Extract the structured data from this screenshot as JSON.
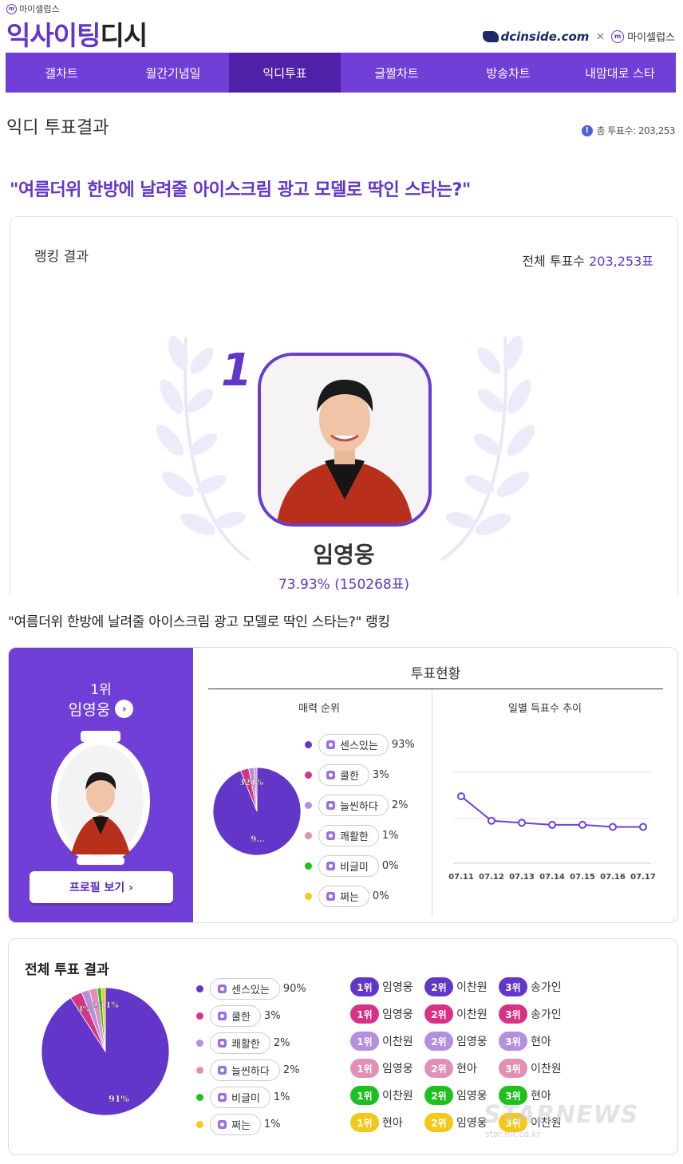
{
  "header": {
    "brand_small": "마이셀럽스",
    "brand_big_part1": "익사이팅",
    "brand_big_part2": "디시",
    "partner_dc": "dcinside.com",
    "partner_times": "×",
    "partner_ms": "마이셀럽스"
  },
  "nav": {
    "items": [
      "갤차트",
      "월간기념일",
      "익디투표",
      "글짤차트",
      "방송차트",
      "내맘대로 스타"
    ],
    "active_index": 2
  },
  "page": {
    "title": "익디 투표결과",
    "total_votes_small": "총 투표수: 203,253",
    "question": "\"여름더위 한방에 날려줄 아이스크림 광고 모델로 딱인 스타는?\""
  },
  "winner": {
    "section_label": "랭킹 결과",
    "total_label": "전체 투표수 ",
    "total_value": "203,253표",
    "rank": "1",
    "name": "임영웅",
    "stats": "73.93% (150268표)"
  },
  "ranking": {
    "heading": "\"여름더위 한방에 날려줄 아이스크림 광고 모델로 딱인 스타는?\" 랭킹",
    "rank_label": "1위",
    "name": "임영웅",
    "profile_button": "프로필 보기 ›",
    "vote_status_title": "투표현황",
    "charm_title": "매력 순위",
    "daily_title": "일별 득표수 추이"
  },
  "colors": {
    "accent": "#6f3fd8",
    "accent_dark": "#4e21a8",
    "pink": "#d63384",
    "lavender": "#b48fe0",
    "lightpink": "#e38fb5",
    "green": "#1fbf1f",
    "yellow": "#f2c81a"
  },
  "charm": {
    "items": [
      {
        "label": "센스있는",
        "pct": "93%",
        "value": 93,
        "color": "#6236c9"
      },
      {
        "label": "쿨한",
        "pct": "3%",
        "value": 3,
        "color": "#d63384"
      },
      {
        "label": "늘씬하다",
        "pct": "2%",
        "value": 2,
        "color": "#b48fe0"
      },
      {
        "label": "쾌활한",
        "pct": "1%",
        "value": 1,
        "color": "#e38fb5"
      },
      {
        "label": "비글미",
        "pct": "0%",
        "value": 0,
        "color": "#1fbf1f"
      },
      {
        "label": "쩌는",
        "pct": "0%",
        "value": 0,
        "color": "#f2c81a"
      }
    ],
    "pie_labels": [
      "321%",
      "9..."
    ]
  },
  "chart_data": [
    {
      "type": "line",
      "x": [
        "07.11",
        "07.12",
        "07.13",
        "07.14",
        "07.15",
        "07.16",
        "07.17"
      ],
      "y": [
        72,
        60,
        59,
        58,
        58,
        57,
        57
      ],
      "title": "일별 득표수 추이",
      "xlabel": "",
      "ylabel": "",
      "ylim": [
        40,
        90
      ],
      "grid": true
    },
    {
      "type": "pie",
      "title": "매력 순위",
      "categories": [
        "센스있는",
        "쿨한",
        "늘씬하다",
        "쾌활한",
        "비글미",
        "쩌는"
      ],
      "values": [
        93,
        3,
        2,
        1,
        0,
        0
      ]
    },
    {
      "type": "pie",
      "title": "전체 투표 결과",
      "categories": [
        "센스있는",
        "쿨한",
        "쾌활한",
        "늘씬하다",
        "비글미",
        "쩌는"
      ],
      "values": [
        90,
        3,
        2,
        2,
        1,
        1
      ]
    }
  ],
  "all_results": {
    "title": "전체 투표 결과",
    "items": [
      {
        "label": "센스있는",
        "pct": "90%",
        "color": "#6236c9"
      },
      {
        "label": "쿨한",
        "pct": "3%",
        "color": "#d63384"
      },
      {
        "label": "쾌활한",
        "pct": "2%",
        "color": "#b48fe0"
      },
      {
        "label": "늘씬하다",
        "pct": "2%",
        "color": "#e38fb5"
      },
      {
        "label": "비글미",
        "pct": "1%",
        "color": "#1fbf1f"
      },
      {
        "label": "쩌는",
        "pct": "1%",
        "color": "#f2c81a"
      }
    ],
    "pie_labels": [
      "91%",
      "3%",
      "2",
      "2",
      "11%"
    ],
    "rank_rows": [
      {
        "color": "#6236c9",
        "names": [
          "임영웅",
          "이찬원",
          "송가인"
        ]
      },
      {
        "color": "#d63384",
        "names": [
          "임영웅",
          "이찬원",
          "송가인"
        ]
      },
      {
        "color": "#b48fe0",
        "names": [
          "이찬원",
          "임영웅",
          "현아"
        ]
      },
      {
        "color": "#e38fb5",
        "names": [
          "임영웅",
          "현아",
          "이찬원"
        ]
      },
      {
        "color": "#1fbf1f",
        "names": [
          "이찬원",
          "임영웅",
          "현아"
        ]
      },
      {
        "color": "#f2c81a",
        "names": [
          "현아",
          "임영웅",
          "이찬원"
        ]
      }
    ],
    "rank_badges": [
      "1위",
      "2위",
      "3위"
    ]
  },
  "watermark": {
    "text": "STARNEWS",
    "url": "star.mt.co.kr"
  }
}
